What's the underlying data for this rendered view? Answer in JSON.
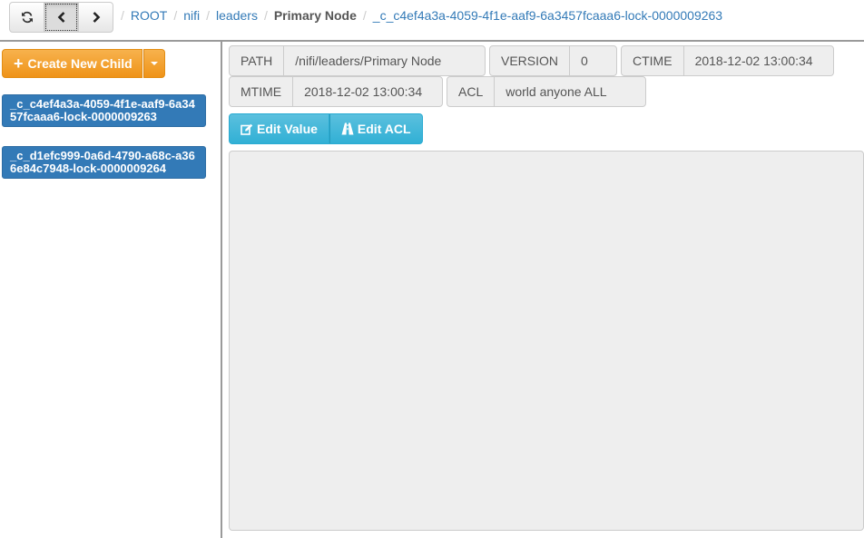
{
  "toolbar": {
    "refresh_icon": "refresh-icon",
    "back_icon": "chevron-left-icon",
    "forward_icon": "chevron-right-icon"
  },
  "breadcrumb": [
    {
      "label": "ROOT",
      "active": false
    },
    {
      "label": "nifi",
      "active": false
    },
    {
      "label": "leaders",
      "active": false
    },
    {
      "label": "Primary Node",
      "active": true
    },
    {
      "label": "_c_c4ef4a3a-4059-4f1e-aaf9-6a3457fcaaa6-lock-0000009263",
      "active": false
    }
  ],
  "sidebar": {
    "create_label": "Create New Child",
    "children": [
      "_c_c4ef4a3a-4059-4f1e-aaf9-6a3457fcaaa6-lock-0000009263",
      "_c_d1efc999-0a6d-4790-a68c-a366e84c7948-lock-0000009264"
    ]
  },
  "details": {
    "path_label": "PATH",
    "path_value": "/nifi/leaders/Primary Node",
    "version_label": "VERSION",
    "version_value": "0",
    "ctime_label": "CTIME",
    "ctime_value": "2018-12-02 13:00:34",
    "mtime_label": "MTIME",
    "mtime_value": "2018-12-02 13:00:34",
    "acl_label": "ACL",
    "acl_value": "world anyone ALL"
  },
  "actions": {
    "edit_value_label": "Edit Value",
    "edit_acl_label": "Edit ACL"
  },
  "value_area": "",
  "colors": {
    "primary": "#337ab7",
    "warning": "#f0ad4e",
    "info": "#5bc0de"
  }
}
